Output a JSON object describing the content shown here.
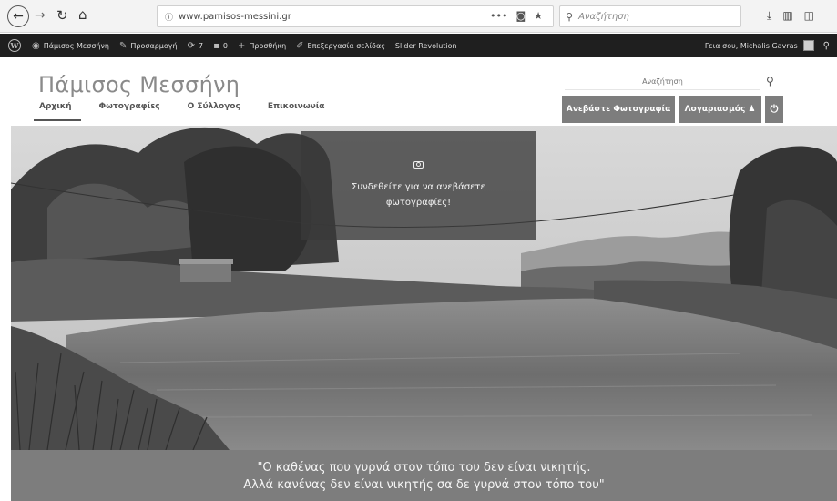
{
  "browser": {
    "url": "www.pamisos-messini.gr",
    "search_placeholder": "Αναζήτηση",
    "icons": [
      "back-arrow-icon",
      "forward-arrow-icon",
      "reload-icon",
      "home-icon",
      "info-icon",
      "page-actions-icon",
      "pocket-icon",
      "bookmark-star-icon",
      "search-icon",
      "download-icon",
      "library-icon",
      "sidebar-icon"
    ]
  },
  "admin_bar": {
    "site_name": "Πάμισος Μεσσήνη",
    "customize": "Προσαρμογή",
    "updates_count": "7",
    "comments_count": "0",
    "new": "Προσθήκη",
    "edit_page": "Επεξεργασία σελίδας",
    "slider": "Slider Revolution",
    "greeting": "Γεια σου, Michalis Gavras"
  },
  "site": {
    "title": "Πάμισος Μεσσήνη",
    "nav": [
      {
        "label": "Αρχική",
        "active": true
      },
      {
        "label": "Φωτογραφίες",
        "active": false
      },
      {
        "label": "Ο Σύλλογος",
        "active": false
      },
      {
        "label": "Επικοινωνία",
        "active": false
      }
    ],
    "search_placeholder": "Αναζήτηση",
    "upload_button": "Ανεβάστε Φωτογραφία",
    "account_button": "Λογαριασμός",
    "power_icon": "power-icon"
  },
  "hero": {
    "login_message": "Συνδεθείτε για να ανεβάσετε φωτογραφίες!"
  },
  "quote": {
    "line1": "\"Ο καθένας που γυρνά στον τόπο του δεν είναι νικητής.",
    "line2": "Αλλά κανένας δεν είναι νικητής σα δε γυρνά στον τόπο του\""
  }
}
